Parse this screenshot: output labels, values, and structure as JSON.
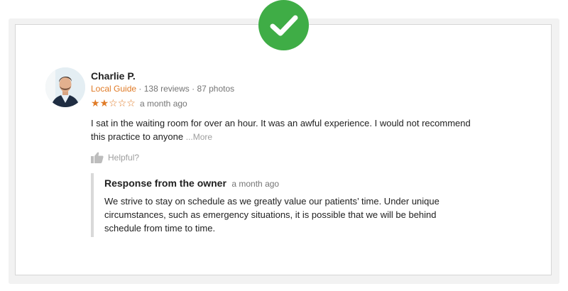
{
  "review": {
    "author_name": "Charlie P.",
    "badge": "Local Guide",
    "reviews_count": "· 138 reviews",
    "photos_count": "· 87 photos",
    "rating": 2,
    "rating_max": 5,
    "time": "a month ago",
    "text": "I sat in the waiting room for over an hour. It was an awful experience. I would not recommend this practice to anyone",
    "more_label": "...More",
    "helpful_label": "Helpful?"
  },
  "owner_response": {
    "title": "Response from the owner",
    "time": "a month ago",
    "text": "We strive to stay on schedule as we greatly value our patients’ time. Under unique circumstances, such as emergency situations, it is possible that we will be behind schedule from time to time."
  },
  "icons": {
    "badge": "checkmark-icon",
    "helpful": "thumbs-up-icon"
  },
  "colors": {
    "accent": "#e07b27",
    "success": "#3fad46",
    "muted": "#757575",
    "border": "#d9d9d9"
  }
}
